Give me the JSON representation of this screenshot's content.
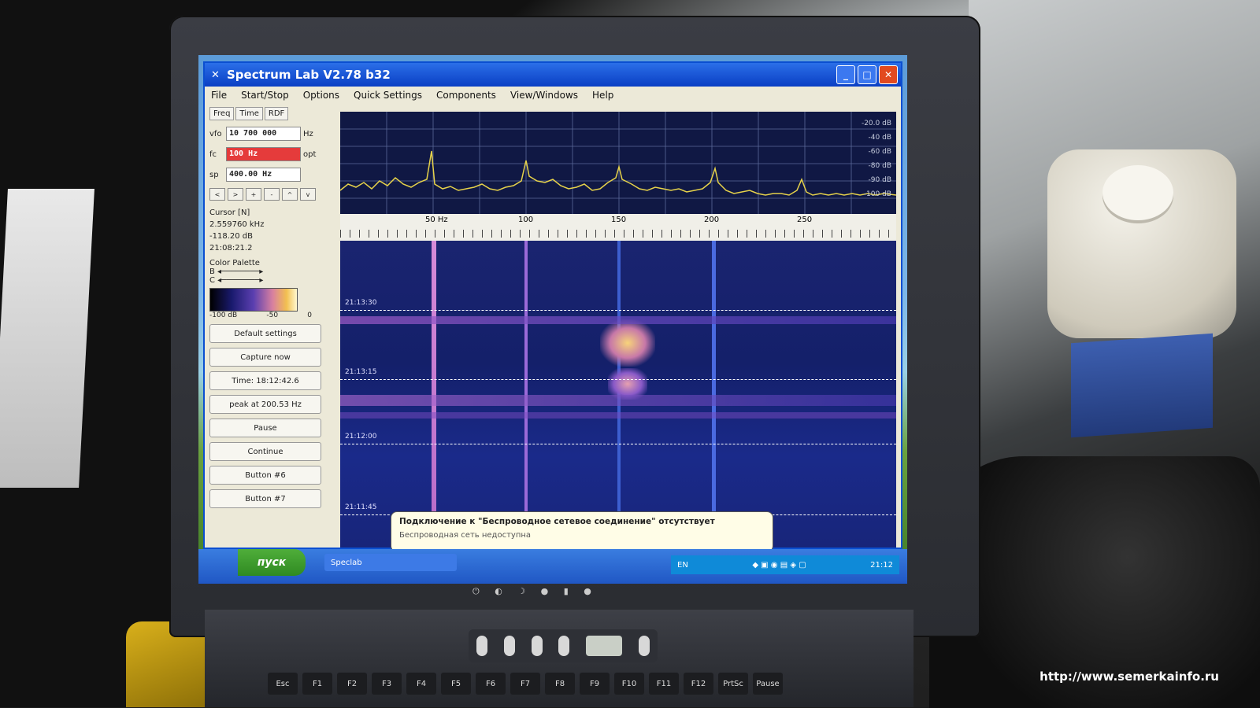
{
  "window": {
    "title": "Spectrum Lab V2.78 b32",
    "menu": [
      "File",
      "Start/Stop",
      "Options",
      "Quick Settings",
      "Components",
      "View/Windows",
      "Help"
    ],
    "buttons": {
      "minimize": "_",
      "maximize": "□",
      "close": "✕"
    }
  },
  "left_panel": {
    "tabs": [
      "Freq",
      "Time",
      "RDF"
    ],
    "vfo_label": "vfo",
    "vfo_value": "10 700 000",
    "vfo_unit": "Hz",
    "fc_label": "fc",
    "fc_value": "100 Hz",
    "fc_unit": "opt",
    "sp_label": "sp",
    "sp_value": "400.00 Hz",
    "nav": [
      "<",
      ">",
      "+",
      "-",
      "^",
      "v"
    ],
    "cursor_title": "Cursor [N]",
    "cursor_freq": "2.559760 kHz",
    "cursor_db": "-118.20 dB",
    "cursor_time": "21:08:21.2",
    "palette_title": "Color Palette",
    "palette_b": "B",
    "palette_c": "C",
    "palette_scale": [
      "-100 dB",
      "-50",
      "0"
    ],
    "buttons": [
      "Default settings",
      "Capture now",
      "Time: 18:12:42.6",
      "peak at 200.53 Hz",
      "Pause",
      "Continue",
      "Button #6",
      "Button #7"
    ]
  },
  "spectrum": {
    "db_labels": [
      "-20.0 dB",
      "-40 dB",
      "-60 dB",
      "-80 dB",
      "-90 dB",
      "-100 dB"
    ],
    "freq_ticks": [
      "50 Hz",
      "100",
      "150",
      "200",
      "250"
    ]
  },
  "waterfall": {
    "time_marks": [
      "21:13:30",
      "21:13:15",
      "21:12:00",
      "21:11:45"
    ]
  },
  "taskbar": {
    "start": "пуск",
    "task": "Speclab",
    "lang": "EN",
    "clock": "21:12"
  },
  "balloon": {
    "title": "Подключение к \"Беспроводное сетевое соединение\" отсутствует",
    "subtitle": "Беспроводная сеть недоступна"
  },
  "keyboard": [
    "Esc",
    "F1",
    "F2",
    "F3",
    "F4",
    "F5",
    "F6",
    "F7",
    "F8",
    "F9",
    "F10",
    "F11",
    "F12",
    "PrtSc",
    "Pause"
  ],
  "watermark": "http://www.semerkainfo.ru",
  "colors": {
    "titlebar": "#0a3fc4",
    "waterfall": "#1a2470",
    "spectrum_trace": "#e6d24a",
    "fc_field": "#e53b3b"
  }
}
